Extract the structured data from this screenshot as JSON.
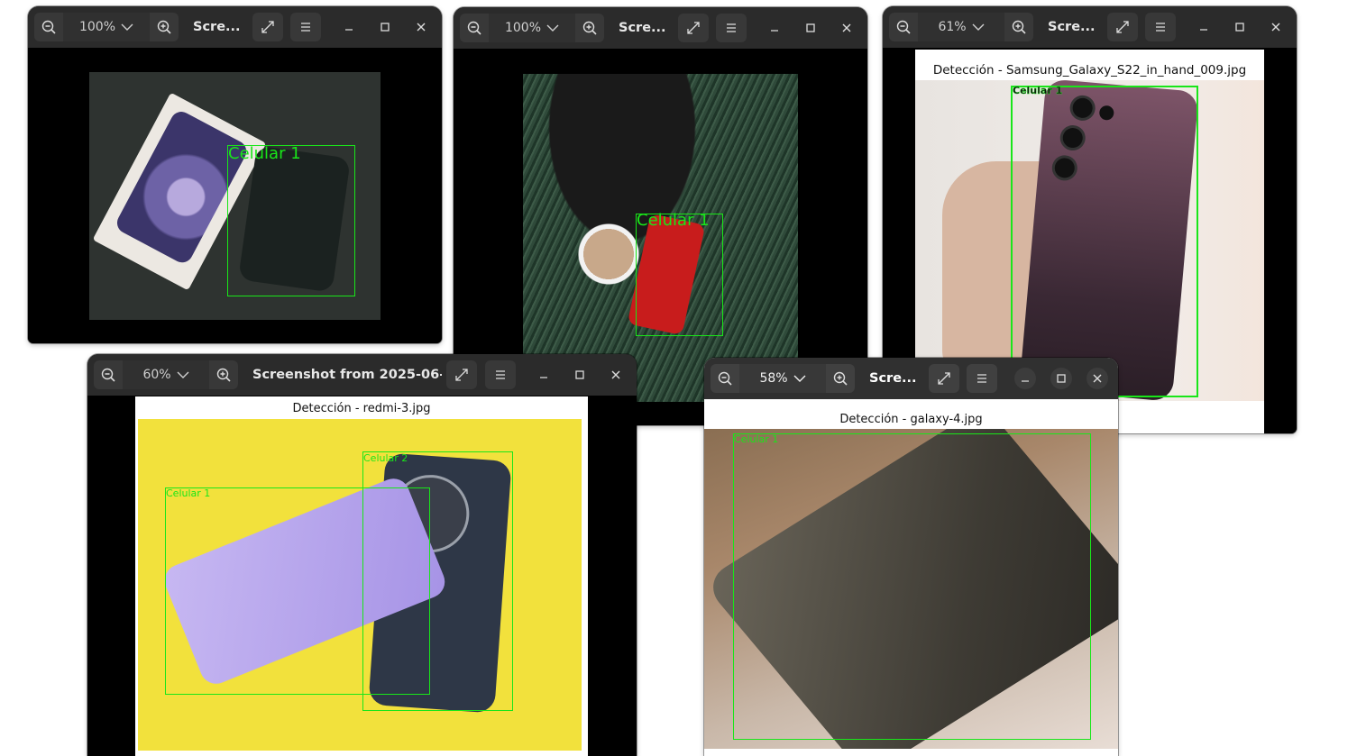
{
  "windows": [
    {
      "zoom": "100%",
      "title": "Scre...",
      "detection_label": "Celular 1"
    },
    {
      "zoom": "100%",
      "title": "Scre...",
      "detection_label": "Celular 1"
    },
    {
      "zoom": "61%",
      "title": "Scre...",
      "caption": "Detección - Samsung_Galaxy_S22_in_hand_009.jpg",
      "detection_label": "Celular 1"
    },
    {
      "zoom": "60%",
      "title": "Screenshot from 2025-06-...",
      "caption": "Detección - redmi-3.jpg",
      "detection_labels": [
        "Celular 1",
        "Celular 2"
      ]
    },
    {
      "zoom": "58%",
      "title": "Scre...",
      "caption": "Detección - galaxy-4.jpg",
      "detection_label": "Celular 1"
    }
  ],
  "colors": {
    "titlebar": "#2b2b2b",
    "detection": "#19e619"
  },
  "icons": [
    "zoom-out-icon",
    "zoom-in-icon",
    "chevron-down-icon",
    "fullscreen-icon",
    "menu-icon",
    "minimize-icon",
    "maximize-icon",
    "close-icon"
  ]
}
